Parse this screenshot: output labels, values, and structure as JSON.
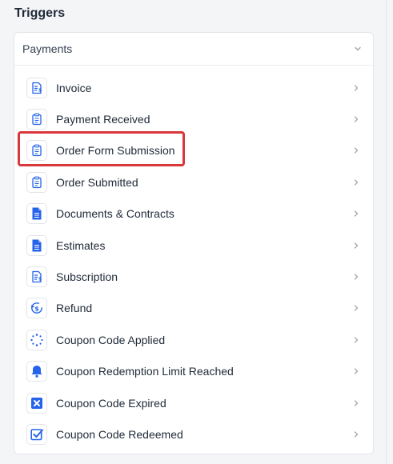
{
  "panel": {
    "title": "Triggers"
  },
  "section": {
    "label": "Payments"
  },
  "items": [
    {
      "label": "Invoice",
      "icon": "invoice-icon"
    },
    {
      "label": "Payment Received",
      "icon": "clipboard-icon"
    },
    {
      "label": "Order Form Submission",
      "icon": "clipboard-icon"
    },
    {
      "label": "Order Submitted",
      "icon": "clipboard-icon"
    },
    {
      "label": "Documents & Contracts",
      "icon": "document-icon"
    },
    {
      "label": "Estimates",
      "icon": "document-icon"
    },
    {
      "label": "Subscription",
      "icon": "invoice-icon"
    },
    {
      "label": "Refund",
      "icon": "refund-icon"
    },
    {
      "label": "Coupon Code Applied",
      "icon": "spinner-icon"
    },
    {
      "label": "Coupon Redemption Limit Reached",
      "icon": "bell-icon"
    },
    {
      "label": "Coupon Code Expired",
      "icon": "x-square-icon"
    },
    {
      "label": "Coupon Code Redeemed",
      "icon": "check-square-icon"
    }
  ],
  "colors": {
    "accent": "#2563eb",
    "highlight": "#d9373a"
  }
}
